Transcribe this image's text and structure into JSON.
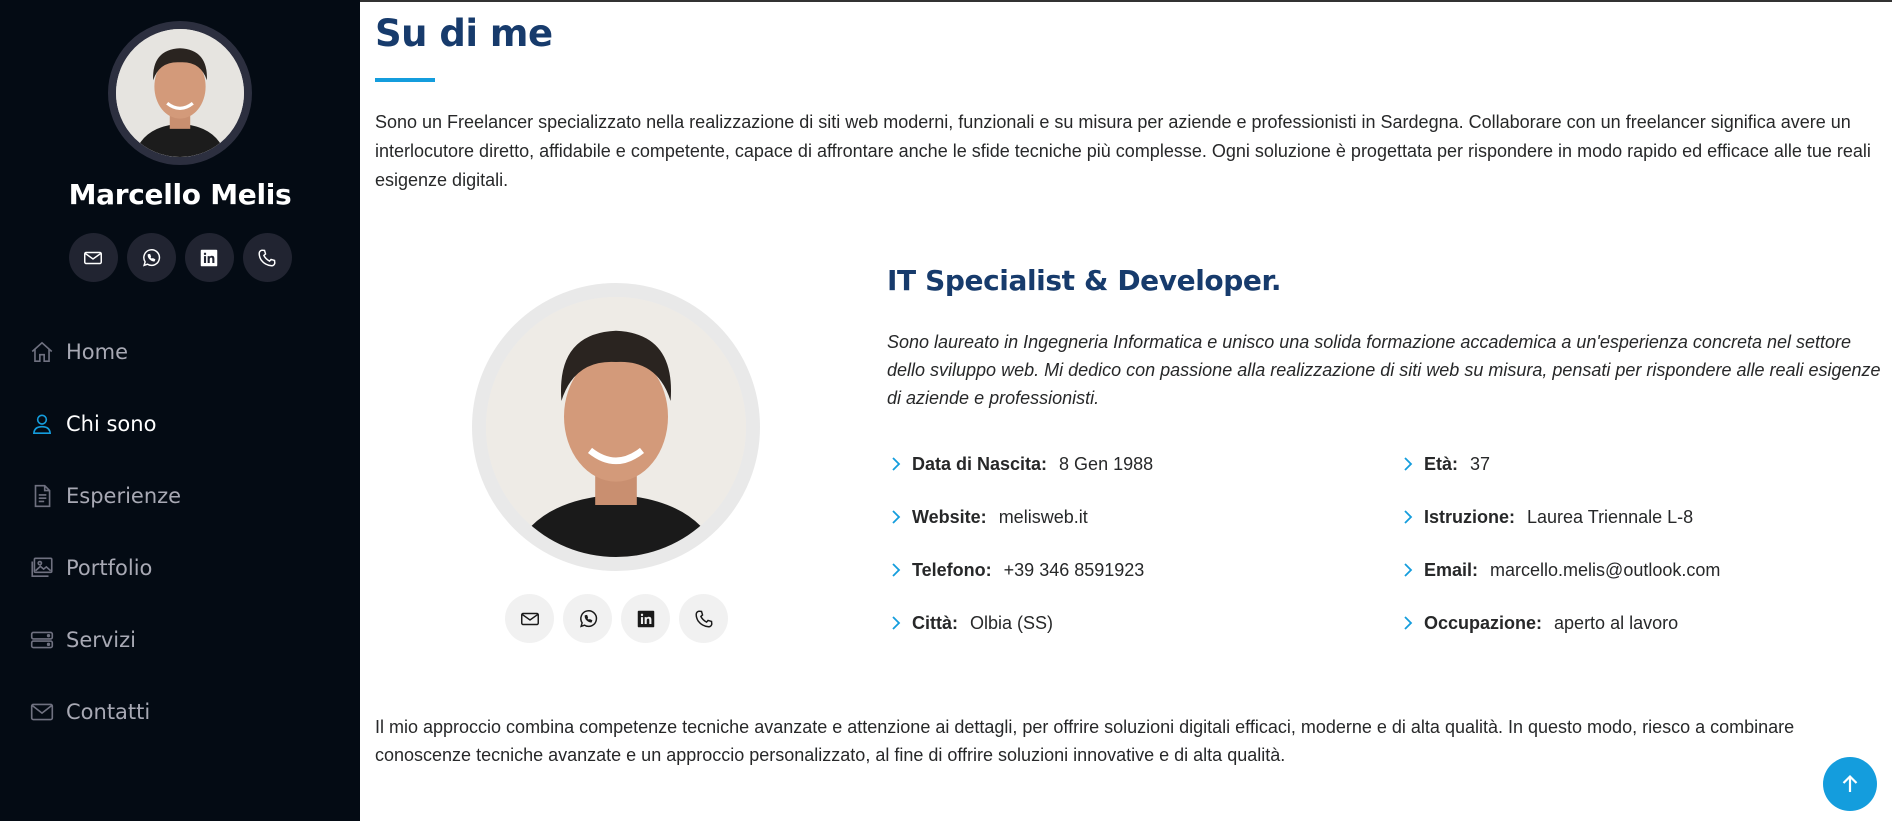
{
  "sidebar": {
    "name": "Marcello Melis",
    "social": [
      {
        "icon": "envelope-icon"
      },
      {
        "icon": "whatsapp-icon"
      },
      {
        "icon": "linkedin-icon"
      },
      {
        "icon": "phone-icon"
      }
    ],
    "nav": [
      {
        "label": "Home",
        "icon": "house-icon"
      },
      {
        "label": "Chi sono",
        "icon": "person-icon",
        "active": true
      },
      {
        "label": "Esperienze",
        "icon": "file-text-icon"
      },
      {
        "label": "Portfolio",
        "icon": "images-icon"
      },
      {
        "label": "Servizi",
        "icon": "hdd-stack-icon"
      },
      {
        "label": "Contatti",
        "icon": "envelope-icon"
      }
    ]
  },
  "about": {
    "title": "Su di me",
    "intro": "Sono un Freelancer specializzato nella realizzazione di siti web moderni, funzionali e su misura per aziende e professionisti in Sardegna. Collaborare con un freelancer significa avere un interlocutore diretto, affidabile e competente, capace di affrontare anche le sfide tecniche più complesse. Ogni soluzione è progettata per rispondere in modo rapido ed efficace alle tue reali esigenze digitali.",
    "role_title": "IT Specialist & Developer.",
    "role_desc": "Sono laureato in Ingegneria Informatica e unisco una solida formazione accademica a un'esperienza concreta nel settore dello sviluppo web. Mi dedico con passione alla realizzazione di siti web su misura, pensati per rispondere alle reali esigenze di aziende e professionisti.",
    "facts_left": [
      {
        "label": "Data di Nascita:",
        "value": "8 Gen 1988"
      },
      {
        "label": "Website:",
        "value": "melisweb.it"
      },
      {
        "label": "Telefono:",
        "value": "+39 346 8591923"
      },
      {
        "label": "Città:",
        "value": "Olbia (SS)"
      }
    ],
    "facts_right": [
      {
        "label": "Età:",
        "value": "37"
      },
      {
        "label": "Istruzione:",
        "value": "Laurea Triennale L-8"
      },
      {
        "label": "Email:",
        "value": "marcello.melis@outlook.com"
      },
      {
        "label": "Occupazione:",
        "value": "aperto al lavoro"
      }
    ],
    "closing": "Il mio approccio combina competenze tecniche avanzate e attenzione ai dettagli, per offrire soluzioni digitali efficaci, moderne e di alta qualità. In questo modo, riesco a combinare conoscenze tecniche avanzate e un approccio personalizzato, al fine di offrire soluzioni innovative e di alta qualità."
  },
  "colors": {
    "sidebar_bg": "#040b14",
    "accent": "#149ddd",
    "heading": "#173b6c"
  },
  "back_to_top": {
    "icon": "arrow-up-icon"
  }
}
